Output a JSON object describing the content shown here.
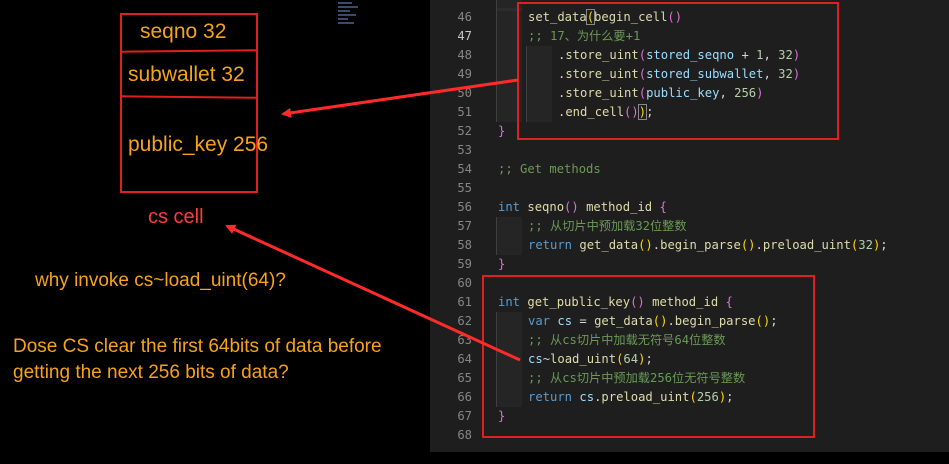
{
  "annotation": {
    "fields": [
      "seqno  32",
      "subwallet 32",
      "public_key  256"
    ],
    "cell_label": "cs cell",
    "question1": "why invoke cs~load_uint(64)?",
    "question2_line1": "Dose CS clear the first 64bits of data before",
    "question2_line2": "getting the next 256 bits of data?"
  },
  "editor": {
    "lines": [
      {
        "n": "46",
        "text": "set_data(begin_cell()"
      },
      {
        "n": "47",
        "text": ";; 17、为什么要+1"
      },
      {
        "n": "48",
        "text": ".store_uint(stored_seqno + 1, 32)"
      },
      {
        "n": "49",
        "text": ".store_uint(stored_subwallet, 32)"
      },
      {
        "n": "50",
        "text": ".store_uint(public_key, 256)"
      },
      {
        "n": "51",
        "text": ".end_cell());"
      },
      {
        "n": "52",
        "text": "}"
      },
      {
        "n": "53",
        "text": ""
      },
      {
        "n": "54",
        "text": ";; Get methods"
      },
      {
        "n": "55",
        "text": ""
      },
      {
        "n": "56",
        "text": "int seqno() method_id {"
      },
      {
        "n": "57",
        "text": ";; 从切片中预加载32位整数"
      },
      {
        "n": "58",
        "text": "return get_data().begin_parse().preload_uint(32);"
      },
      {
        "n": "59",
        "text": "}"
      },
      {
        "n": "60",
        "text": ""
      },
      {
        "n": "61",
        "text": "int get_public_key() method_id {"
      },
      {
        "n": "62",
        "text": "var cs = get_data().begin_parse();"
      },
      {
        "n": "63",
        "text": ";; 从cs切片中加载无符号64位整数"
      },
      {
        "n": "64",
        "text": "cs~load_uint(64);"
      },
      {
        "n": "65",
        "text": ";; 从cs切片中预加载256位无符号整数"
      },
      {
        "n": "66",
        "text": "return cs.preload_uint(256);"
      },
      {
        "n": "67",
        "text": "}"
      },
      {
        "n": "68",
        "text": ""
      }
    ],
    "active_line": "47"
  },
  "colors": {
    "annotation_text": "#f7a21b",
    "annotation_red": "#e02020",
    "editor_bg": "#1e1e1e",
    "keyword": "#569cd6",
    "function": "#dcdcaa",
    "comment": "#6a9955",
    "number": "#b5cea8"
  }
}
